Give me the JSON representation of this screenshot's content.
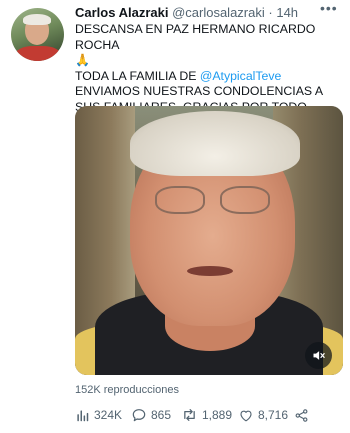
{
  "tweet": {
    "author_name": "Carlos Alazraki",
    "author_handle": "@carlosalazraki",
    "separator": "·",
    "time": "14h",
    "more_label": "•••",
    "line1": "DESCANSA EN PAZ HERMANO RICARDO ROCHA",
    "emoji": "🙏",
    "line2_prefix": "TODA LA FAMILIA DE ",
    "mention": "@AtypicalTeve",
    "line2_suffix": " ENVIAMOS NUESTRAS CONDOLENCIAS A SUS FAMILIARES, GRACIAS POR TODO. VUELA ALTO!!!",
    "views": "152K reproducciones"
  },
  "actions": {
    "analytics": "324K",
    "replies": "865",
    "retweets": "1,889",
    "likes": "8,716"
  },
  "icons": {
    "analytics": "bar-chart-icon",
    "reply": "speech-bubble-icon",
    "retweet": "retweet-icon",
    "like": "heart-icon",
    "share": "share-icon",
    "mute": "speaker-muted-icon"
  },
  "colors": {
    "text": "#0f1419",
    "secondary": "#536471",
    "link": "#1d9bf0"
  }
}
